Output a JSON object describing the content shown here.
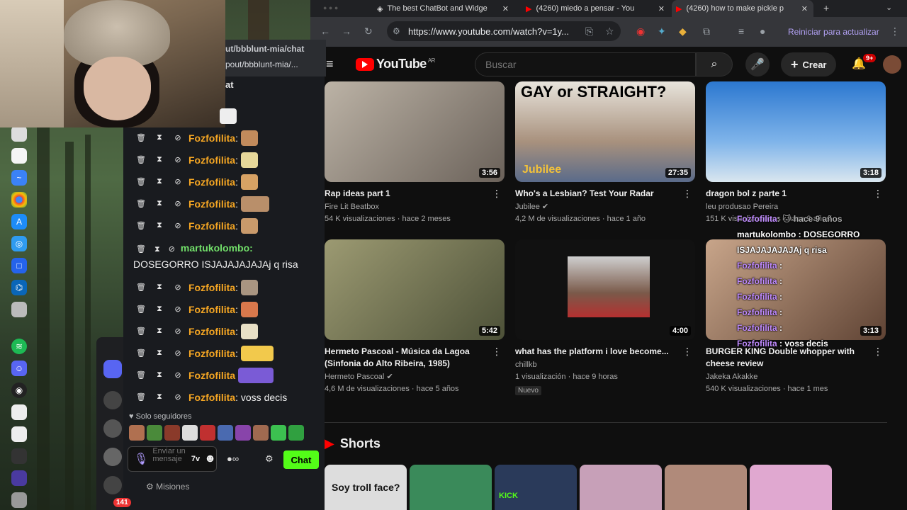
{
  "webcam": {
    "label": "streamer webcam"
  },
  "chat_popout": {
    "url_title": "ut/bbblunt-mia/chat",
    "url_line": "pout/bbblunt-mia/...",
    "header": "at",
    "messages": [
      {
        "user": "Fozfofilita",
        "text": ""
      },
      {
        "user": "Fozfofilita",
        "text": ""
      },
      {
        "user": "Fozfofilita",
        "text": ""
      },
      {
        "user": "Fozfofilita",
        "text": ""
      },
      {
        "user": "Fozfofilita",
        "text": ""
      },
      {
        "user": "Fozfofilita",
        "text": ""
      }
    ],
    "long_message": {
      "user": "martukolombo:",
      "text": "DOSEGORRO ISJAJAJAJAJAj q risa"
    },
    "messages2": [
      {
        "user": "Fozfofilita",
        "text": ""
      },
      {
        "user": "Fozfofilita",
        "text": ""
      },
      {
        "user": "Fozfofilita",
        "text": ""
      },
      {
        "user": "Fozfofilita",
        "text": ""
      },
      {
        "user": "Fozfofilita",
        "text": ""
      }
    ],
    "last_message": {
      "user": "Fozfofilita",
      "text": ": voss decis"
    },
    "followers_only": "Solo seguidores",
    "input_placeholder": "Enviar un mensaje",
    "send_label": "Chat",
    "missions_label": "Misiones",
    "discord_badge": "141"
  },
  "browser": {
    "tabs": [
      {
        "title": "The best ChatBot and Widge"
      },
      {
        "title": "(4260) miedo a pensar - You"
      },
      {
        "title": "(4260) how to make pickle p"
      }
    ],
    "url": "https://www.youtube.com/watch?v=1y...",
    "update_label": "Reiniciar para actualizar"
  },
  "youtube": {
    "logo": "YouTube",
    "country": "AR",
    "search_placeholder": "Buscar",
    "create_label": "Crear",
    "notif_count": "9+",
    "videos": [
      {
        "title": "Rap ideas part 1",
        "channel": "Fire Lit Beatbox",
        "meta": "54 K visualizaciones · hace 2 meses",
        "duration": "3:56",
        "color": "#8b8378"
      },
      {
        "title": "Who's a Lesbian? Test Your Radar",
        "channel": "Jubilee",
        "meta": "4,2 M de visualizaciones · hace 1 año",
        "duration": "27:35",
        "color": "#c9b9a4"
      },
      {
        "title": "dragon bol z parte 1",
        "channel": "leu produsao Pereira",
        "meta": "151 K visualizaciones · hace 9 años",
        "duration": "3:18",
        "color": "#3f7fc8"
      },
      {
        "title": "Hermeto Pascoal - Música da Lagoa (Sinfonia do Alto Ribeira, 1985)",
        "channel": "Hermeto Pascoal",
        "meta": "4,6 M de visualizaciones · hace 5 años",
        "duration": "5:42",
        "color": "#6b6a4f"
      },
      {
        "title": "what has the platform i love become...",
        "channel": "chillkb",
        "meta": "1 visualización · hace 9 horas",
        "duration": "4:00",
        "color": "#111111",
        "badge": "Nuevo"
      },
      {
        "title": "BURGER KING Double whopper with cheese review",
        "channel": "Jakeka Akakke",
        "meta": "540 K visualizaciones · hace 1 mes",
        "duration": "3:13",
        "color": "#8a6a55"
      }
    ],
    "thumb_text": {
      "gay": "GAY or STRAIGHT?",
      "jubilee": "Jubilee"
    },
    "shorts_label": "Shorts",
    "shorts_text": [
      "Soy troll face?",
      "",
      "KICK",
      "",
      "",
      ""
    ]
  },
  "overlay_chat": [
    {
      "user": "Fozfofilita",
      "text": ": 🐱 hace 9 años"
    },
    {
      "user": "",
      "text": "martukolombo : DOSEGORRO"
    },
    {
      "user": "",
      "text": "ISJAJAJAJAJAj q risa"
    },
    {
      "user": "Fozfofilita",
      "text": " :"
    },
    {
      "user": "Fozfofilita",
      "text": " :"
    },
    {
      "user": "Fozfofilita",
      "text": " :"
    },
    {
      "user": "Fozfofilita",
      "text": " :"
    },
    {
      "user": "Fozfofilita",
      "text": " :"
    },
    {
      "user": "Fozfofilita",
      "text": " : voss decis"
    }
  ]
}
